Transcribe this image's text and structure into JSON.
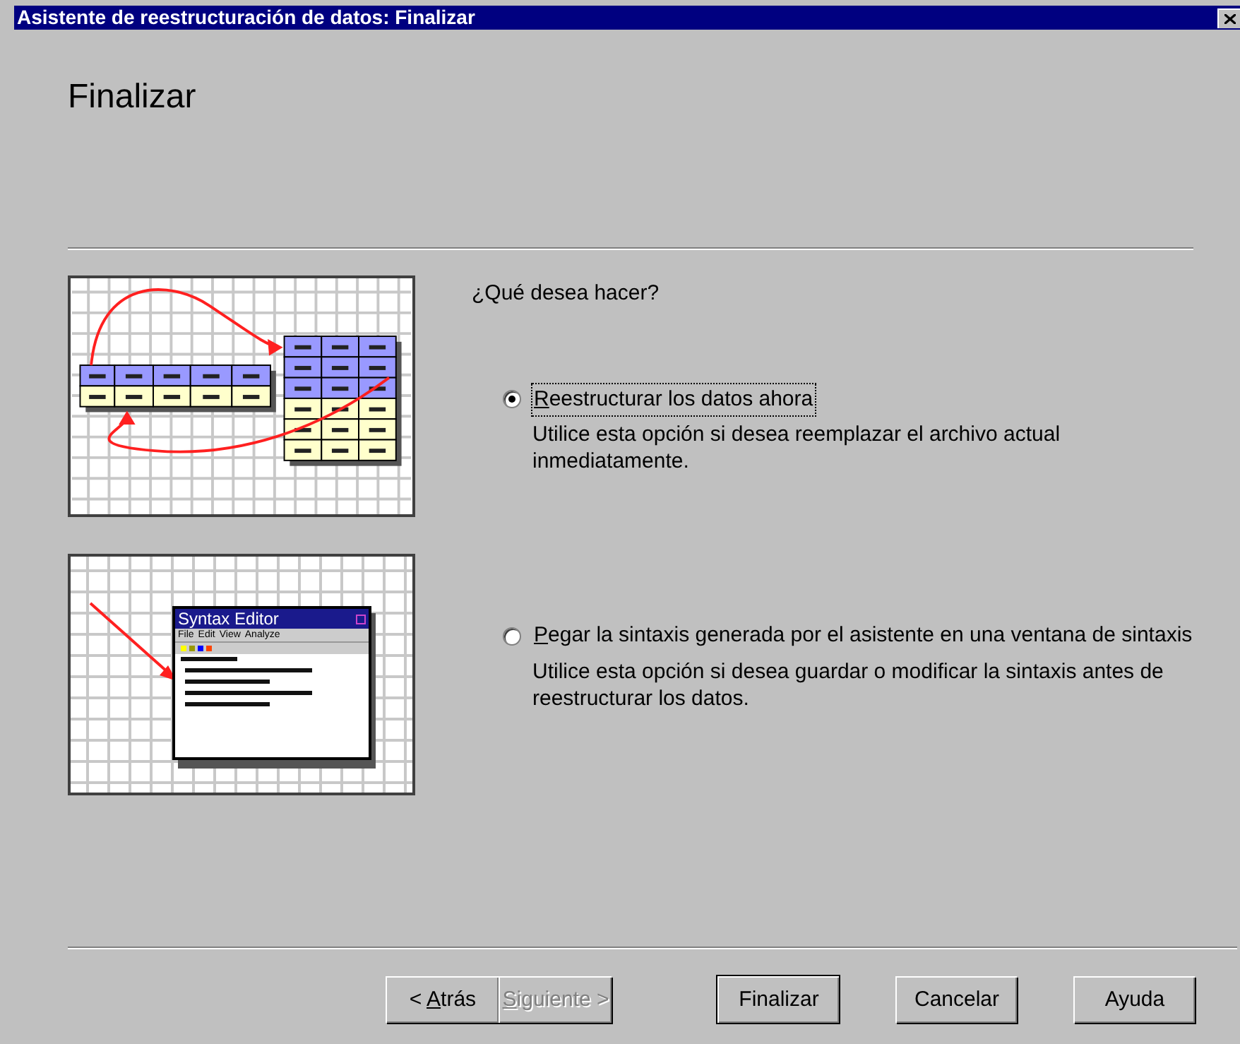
{
  "window": {
    "title": "Asistente de reestructuración de datos: Finalizar"
  },
  "heading": "Finalizar",
  "illustrations": [
    {
      "kind": "restructure"
    },
    {
      "kind": "syntax",
      "window_title": "Syntax Editor",
      "menu": [
        "File",
        "Edit",
        "View",
        "Analyze"
      ]
    }
  ],
  "question": "¿Qué desea hacer?",
  "options": [
    {
      "label": "Reestructurar los datos ahora",
      "description": "Utilice esta opción si desea reemplazar el archivo actual inmediatamente.",
      "selected": true,
      "focused": true,
      "mnemonic": true
    },
    {
      "label": "Pegar la sintaxis generada por el asistente en una ventana de sintaxis",
      "description": "Utilice esta opción si desea guardar o modificar la sintaxis antes de reestructurar los datos.",
      "selected": false,
      "focused": false,
      "mnemonic": true
    }
  ],
  "buttons": [
    {
      "label": "< Atrás",
      "disabled": false,
      "default": false,
      "mnemonic": true
    },
    {
      "label": "Siguiente >",
      "disabled": true,
      "default": false,
      "mnemonic": true
    },
    {
      "label": "Finalizar",
      "disabled": false,
      "default": true,
      "mnemonic": false
    },
    {
      "label": "Cancelar",
      "disabled": false,
      "default": false,
      "mnemonic": false
    },
    {
      "label": "Ayuda",
      "disabled": false,
      "default": false,
      "mnemonic": false
    }
  ]
}
